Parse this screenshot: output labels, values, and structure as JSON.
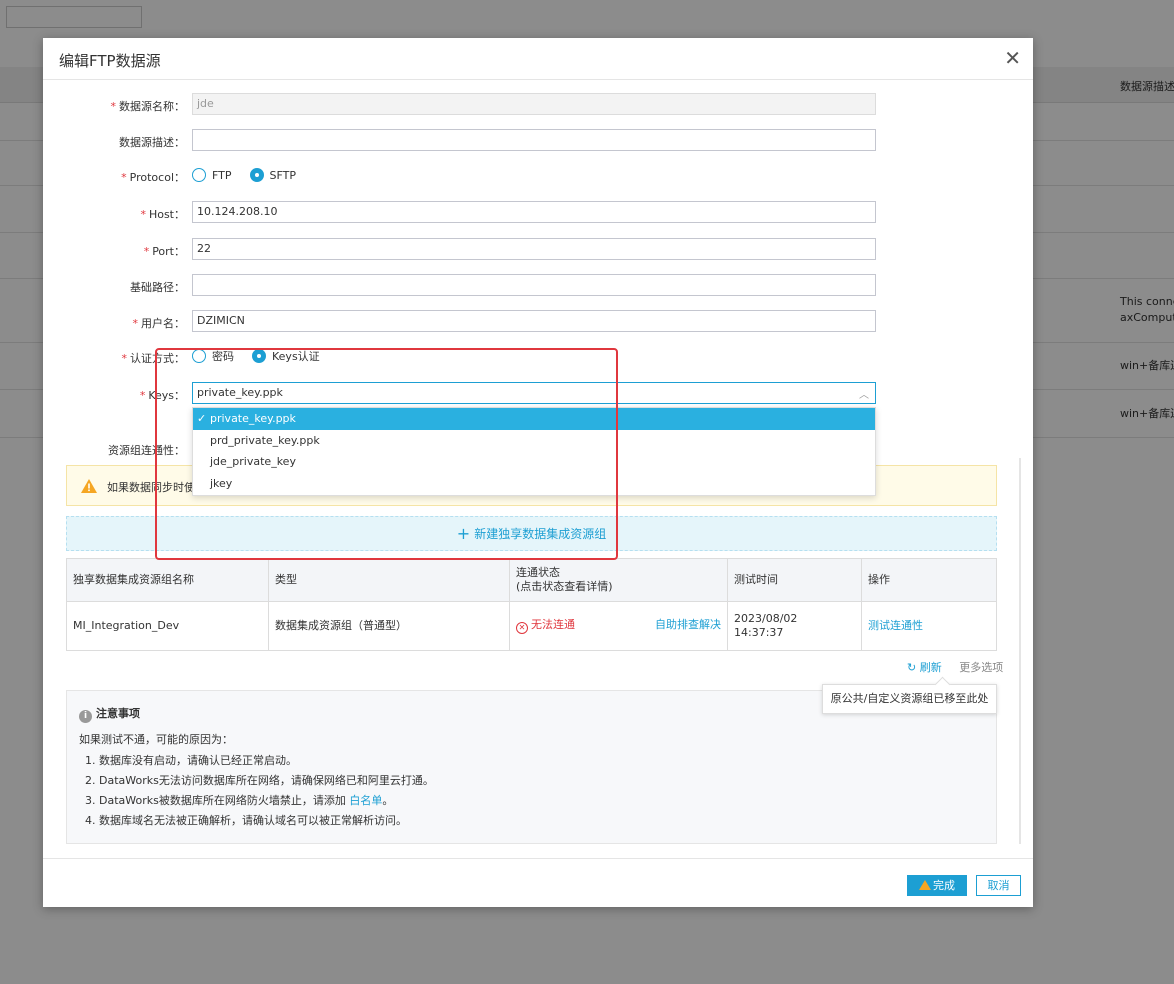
{
  "background": {
    "header_col": "数据源描述",
    "rows": [
      {
        "line1": "This connec",
        "line2": "axCompute"
      },
      {
        "line1": "win+备库连"
      },
      {
        "line1": "win+备库连"
      }
    ]
  },
  "modal": {
    "title": "编辑FTP数据源",
    "close_icon": "✕",
    "fields": {
      "name": {
        "label": "数据源名称：",
        "value": "jde"
      },
      "desc": {
        "label": "数据源描述：",
        "value": ""
      },
      "protocol": {
        "label": "Protocol：",
        "options": [
          "FTP",
          "SFTP"
        ],
        "selected": "SFTP"
      },
      "host": {
        "label": "Host：",
        "value": "10.124.208.10"
      },
      "port": {
        "label": "Port：",
        "value": "22"
      },
      "base_path": {
        "label": "基础路径：",
        "value": ""
      },
      "username": {
        "label": "用户名：",
        "value": "DZIMICN"
      },
      "auth": {
        "label": "认证方式：",
        "options": [
          "密码",
          "Keys认证"
        ],
        "selected": "Keys认证"
      },
      "keys": {
        "label": "Keys：",
        "value": "private_key.ppk",
        "options": [
          "private_key.ppk",
          "prd_private_key.ppk",
          "jde_private_key",
          "jkey"
        ]
      },
      "resource_connectivity": {
        "label": "资源组连通性："
      }
    },
    "warning": "如果数据同步时使",
    "add_group": "新建独享数据集成资源组",
    "table": {
      "headers": [
        "独享数据集成资源组名称",
        "类型",
        "连通状态",
        "(点击状态查看详情)",
        "测试时间",
        "操作"
      ],
      "rows": [
        {
          "name": "MI_Integration_Dev",
          "type": "数据集成资源组（普通型）",
          "status": "无法连通",
          "self_check": "自助排查解决",
          "time_date": "2023/08/02",
          "time_clock": "14:37:37",
          "action": "测试连通性"
        }
      ]
    },
    "refresh": "刷新",
    "more_options": "更多选项",
    "tooltip": "原公共/自定义资源组已移至此处",
    "notice": {
      "title": "注意事项",
      "intro": "如果测试不通，可能的原因为：",
      "items": [
        "1.  数据库没有启动，请确认已经正常启动。",
        "2.  DataWorks无法访问数据库所在网络，请确保网络已和阿里云打通。",
        "3.  DataWorks被数据库所在网络防火墙禁止，请添加 ",
        "4.  数据库域名无法被正确解析，请确认域名可以被正常解析访问。"
      ],
      "whitelist_link": "白名单",
      "item3_end": "。"
    },
    "footer": {
      "confirm": "完成",
      "cancel": "取消"
    }
  },
  "colors": {
    "accent": "#1d9fd3",
    "error": "#e0373e",
    "warning": "#f5a623"
  }
}
